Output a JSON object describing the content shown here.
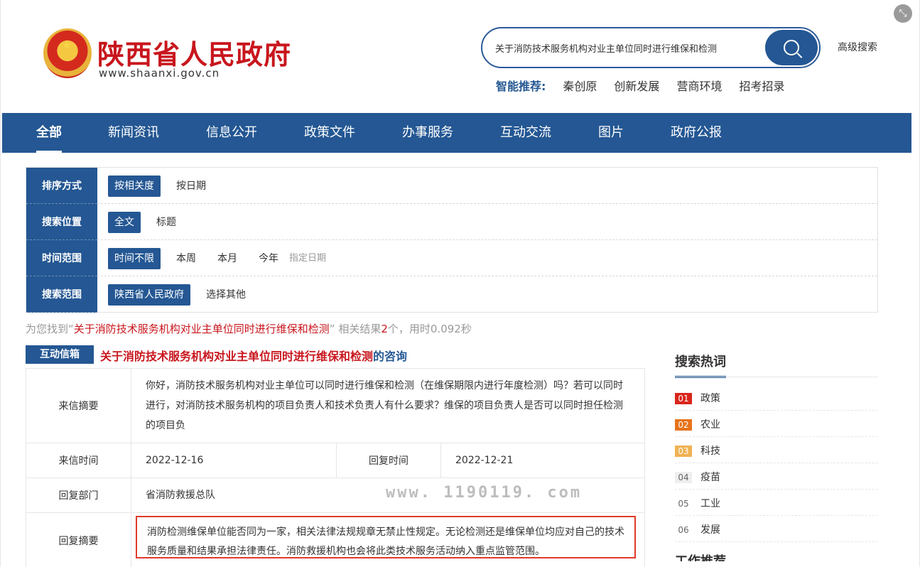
{
  "header": {
    "site_title": "陕西省人民政府",
    "site_url": "www.shaanxi.gov.cn",
    "search_value": "关于消防技术服务机构对业主单位同时进行维保和检测",
    "advanced_search": "高级搜索",
    "recommend_label": "智能推荐:",
    "recommend": [
      "秦创原",
      "创新发展",
      "营商环境",
      "招考招录"
    ]
  },
  "nav": [
    "全部",
    "新闻资讯",
    "信息公开",
    "政策文件",
    "办事服务",
    "互动交流",
    "图片",
    "政府公报"
  ],
  "filters": [
    {
      "label": "排序方式",
      "options": [
        "按相关度",
        "按日期"
      ]
    },
    {
      "label": "搜索位置",
      "options": [
        "全文",
        "标题"
      ]
    },
    {
      "label": "时间范围",
      "options": [
        "时间不限",
        "本周",
        "本月",
        "今年"
      ],
      "extra": "指定日期"
    },
    {
      "label": "搜索范围",
      "options": [
        "陕西省人民政府",
        "选择其他"
      ]
    }
  ],
  "summary": {
    "prefix": "为您找到“",
    "keyword": "关于消防技术服务机构对业主单位同时进行维保和检测",
    "middle": "” 相关结果",
    "count": "2",
    "suffix": "个，用时0.092秒"
  },
  "result": {
    "tag": "互动信箱",
    "title_hl": "关于消防技术服务机构对业主单位同时进行维保和检测",
    "title_rest": "的咨询",
    "letter_label": "来信摘要",
    "letter_text": "你好，消防技术服务机构对业主单位可以同时进行维保和检测（在维保期限内进行年度检测）吗？若可以同时进行，对消防技术服务机构的项目负责人和技术负责人有什么要求？维保的项目负责人是否可以同时担任检测的项目负",
    "letter_time_label": "来信时间",
    "letter_time": "2022-12-16",
    "reply_time_label": "回复时间",
    "reply_time": "2022-12-21",
    "dept_label": "回复部门",
    "dept": "省消防救援总队",
    "reply_label": "回复摘要",
    "reply_text": "消防检测维保单位能否同为一家，相关法律法规规章无禁止性规定。无论检测还是维保单位均应对自己的技术服务质量和结果承担法律责任。消防救援机构也会将此类技术服务活动纳入重点监管范围。"
  },
  "watermark": "www. 1190119. com",
  "hot": {
    "title": "搜索热词",
    "items": [
      {
        "rank": "01",
        "word": "政策"
      },
      {
        "rank": "02",
        "word": "农业"
      },
      {
        "rank": "03",
        "word": "科技"
      },
      {
        "rank": "04",
        "word": "疫苗"
      },
      {
        "rank": "05",
        "word": "工业"
      },
      {
        "rank": "06",
        "word": "发展"
      }
    ],
    "title2": "工作推荐"
  }
}
